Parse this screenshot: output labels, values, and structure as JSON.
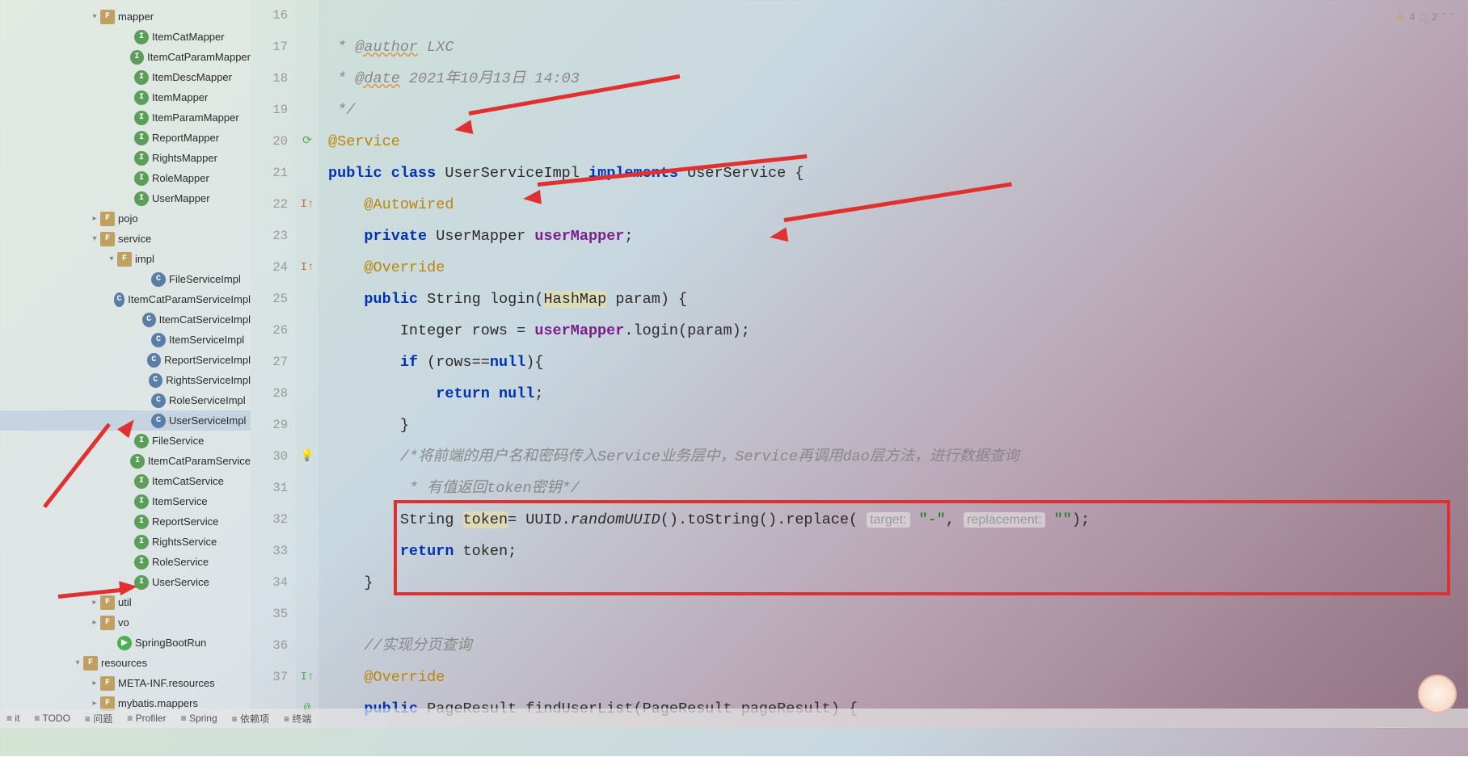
{
  "tree": {
    "items": [
      {
        "indent": 110,
        "chev": "▾",
        "icon": "F",
        "iconCls": "ico-folder",
        "label": "mapper"
      },
      {
        "indent": 152,
        "chev": "",
        "icon": "I",
        "iconCls": "ico-interface",
        "label": "ItemCatMapper"
      },
      {
        "indent": 152,
        "chev": "",
        "icon": "I",
        "iconCls": "ico-interface",
        "label": "ItemCatParamMapper"
      },
      {
        "indent": 152,
        "chev": "",
        "icon": "I",
        "iconCls": "ico-interface",
        "label": "ItemDescMapper"
      },
      {
        "indent": 152,
        "chev": "",
        "icon": "I",
        "iconCls": "ico-interface",
        "label": "ItemMapper"
      },
      {
        "indent": 152,
        "chev": "",
        "icon": "I",
        "iconCls": "ico-interface",
        "label": "ItemParamMapper"
      },
      {
        "indent": 152,
        "chev": "",
        "icon": "I",
        "iconCls": "ico-interface",
        "label": "ReportMapper"
      },
      {
        "indent": 152,
        "chev": "",
        "icon": "I",
        "iconCls": "ico-interface",
        "label": "RightsMapper"
      },
      {
        "indent": 152,
        "chev": "",
        "icon": "I",
        "iconCls": "ico-interface",
        "label": "RoleMapper"
      },
      {
        "indent": 152,
        "chev": "",
        "icon": "I",
        "iconCls": "ico-interface",
        "label": "UserMapper"
      },
      {
        "indent": 110,
        "chev": "▸",
        "icon": "F",
        "iconCls": "ico-folder",
        "label": "pojo"
      },
      {
        "indent": 110,
        "chev": "▾",
        "icon": "F",
        "iconCls": "ico-folder",
        "label": "service"
      },
      {
        "indent": 131,
        "chev": "▾",
        "icon": "F",
        "iconCls": "ico-folder",
        "label": "impl"
      },
      {
        "indent": 173,
        "chev": "",
        "icon": "C",
        "iconCls": "ico-class",
        "label": "FileServiceImpl"
      },
      {
        "indent": 173,
        "chev": "",
        "icon": "C",
        "iconCls": "ico-class",
        "label": "ItemCatParamServiceImpl"
      },
      {
        "indent": 173,
        "chev": "",
        "icon": "C",
        "iconCls": "ico-class",
        "label": "ItemCatServiceImpl"
      },
      {
        "indent": 173,
        "chev": "",
        "icon": "C",
        "iconCls": "ico-class",
        "label": "ItemServiceImpl"
      },
      {
        "indent": 173,
        "chev": "",
        "icon": "C",
        "iconCls": "ico-class",
        "label": "ReportServiceImpl"
      },
      {
        "indent": 173,
        "chev": "",
        "icon": "C",
        "iconCls": "ico-class",
        "label": "RightsServiceImpl"
      },
      {
        "indent": 173,
        "chev": "",
        "icon": "C",
        "iconCls": "ico-class",
        "label": "RoleServiceImpl"
      },
      {
        "indent": 173,
        "chev": "",
        "icon": "C",
        "iconCls": "ico-class",
        "label": "UserServiceImpl",
        "selected": true
      },
      {
        "indent": 152,
        "chev": "",
        "icon": "I",
        "iconCls": "ico-interface",
        "label": "FileService"
      },
      {
        "indent": 152,
        "chev": "",
        "icon": "I",
        "iconCls": "ico-interface",
        "label": "ItemCatParamService"
      },
      {
        "indent": 152,
        "chev": "",
        "icon": "I",
        "iconCls": "ico-interface",
        "label": "ItemCatService"
      },
      {
        "indent": 152,
        "chev": "",
        "icon": "I",
        "iconCls": "ico-interface",
        "label": "ItemService"
      },
      {
        "indent": 152,
        "chev": "",
        "icon": "I",
        "iconCls": "ico-interface",
        "label": "ReportService"
      },
      {
        "indent": 152,
        "chev": "",
        "icon": "I",
        "iconCls": "ico-interface",
        "label": "RightsService"
      },
      {
        "indent": 152,
        "chev": "",
        "icon": "I",
        "iconCls": "ico-interface",
        "label": "RoleService"
      },
      {
        "indent": 152,
        "chev": "",
        "icon": "I",
        "iconCls": "ico-interface",
        "label": "UserService"
      },
      {
        "indent": 110,
        "chev": "▸",
        "icon": "F",
        "iconCls": "ico-folder",
        "label": "util"
      },
      {
        "indent": 110,
        "chev": "▸",
        "icon": "F",
        "iconCls": "ico-folder",
        "label": "vo"
      },
      {
        "indent": 131,
        "chev": "",
        "icon": "▶",
        "iconCls": "ico-run",
        "label": "SpringBootRun"
      },
      {
        "indent": 89,
        "chev": "▾",
        "icon": "F",
        "iconCls": "ico-folder",
        "label": "resources"
      },
      {
        "indent": 110,
        "chev": "▸",
        "icon": "F",
        "iconCls": "ico-folder",
        "label": "META-INF.resources"
      },
      {
        "indent": 110,
        "chev": "▸",
        "icon": "F",
        "iconCls": "ico-folder",
        "label": "mybatis.mappers"
      }
    ]
  },
  "gutter": {
    "lines": [
      "16",
      "17",
      "18",
      "19",
      "20",
      "21",
      "22",
      "23",
      "24",
      "25",
      "26",
      "27",
      "28",
      "29",
      "30",
      "31",
      "32",
      "33",
      "34",
      "35",
      "36",
      "37"
    ],
    "icons": {
      "20": "run",
      "22": "impl",
      "24": "impl",
      "30": "bulb",
      "37": "over"
    }
  },
  "code": {
    "l16_pre": " * ",
    "l16_tag": "@author",
    "l16_rest": " LXC",
    "l17_pre": " * ",
    "l17_tag": "@date",
    "l17_rest": " 2021年10月13日 14:03",
    "l18": " */",
    "l19": "@Service",
    "l20_kw1": "public",
    "l20_kw2": "class",
    "l20_name": "UserServiceImpl",
    "l20_impl": "implements",
    "l20_iface": "UserService {",
    "l21": "    @Autowired",
    "l22_kw": "private",
    "l22_type": "UserMapper",
    "l22_field": "userMapper",
    "l22_semi": ";",
    "l23": "    @Override",
    "l24_kw": "public",
    "l24_type": "String",
    "l24_method": "login",
    "l24_param_type": "HashMap",
    "l24_param_name": " param) {",
    "l25_pre": "        Integer rows = ",
    "l25_field": "userMapper",
    "l25_rest": ".login(param);",
    "l26_kw": "if",
    "l26_rest": " (rows==",
    "l26_null": "null",
    "l26_close": "){",
    "l27_ret": "return",
    "l27_null": "null",
    "l27_semi": ";",
    "l28": "        }",
    "l29": "        /*将前端的用户名和密码传入Service业务层中，Service再调用dao层方法，进行数据查询",
    "l30": "         * 有值返回token密钥*/",
    "l31_pre": "        String ",
    "l31_var": "token",
    "l31_eq": "= UUID.",
    "l31_static": "randomUUID",
    "l31_mid": "().toString().replace( ",
    "l31_hint1": "target:",
    "l31_str1": " \"-\"",
    "l31_comma": ", ",
    "l31_hint2": "replacement:",
    "l31_str2": " \"\"",
    "l31_end": ");",
    "l32_ret": "return",
    "l32_var": " token;",
    "l33": "    }",
    "l34": "",
    "l35": "    //实现分页查询",
    "l36": "    @Override",
    "l37_kw": "public",
    "l37_rest": " PageResult findUserList(PageResult pageResult) {"
  },
  "status": {
    "warn_count": "4",
    "typo_count": "2"
  },
  "bottom": {
    "items": [
      "it",
      "TODO",
      "问题",
      "Profiler",
      "Spring",
      "依赖项",
      "终端"
    ]
  }
}
